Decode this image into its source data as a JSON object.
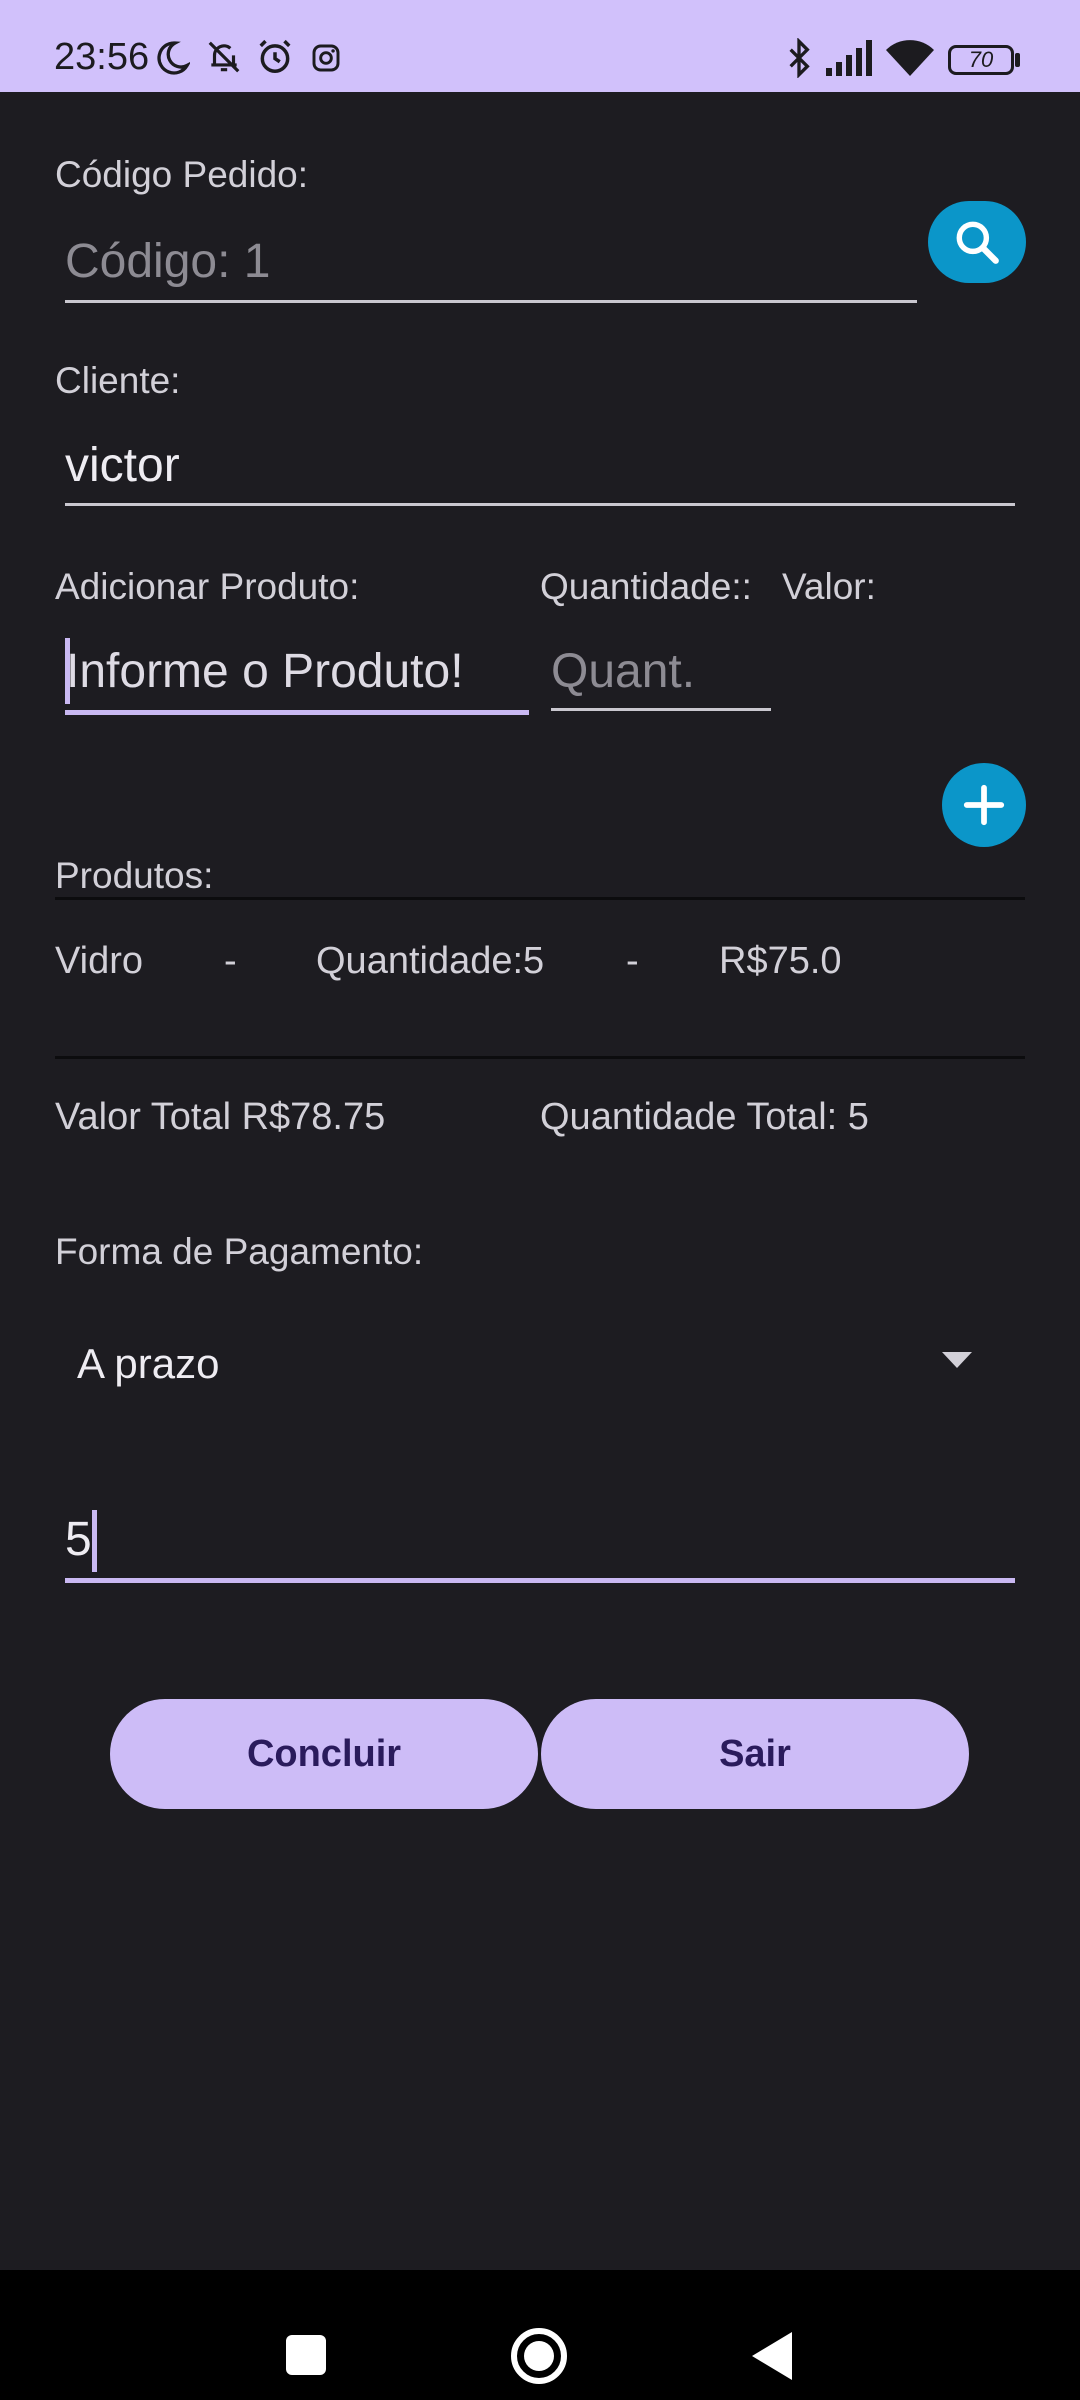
{
  "status_bar": {
    "time": "23:56",
    "battery": "70",
    "icons": [
      "moon-icon",
      "bell-off-icon",
      "alarm-icon",
      "instagram-icon",
      "bluetooth-icon",
      "signal-icon",
      "wifi-icon",
      "battery-icon"
    ]
  },
  "order": {
    "code_label": "Código Pedido:",
    "code_placeholder": "Código: 1",
    "search_icon": "search-icon"
  },
  "client": {
    "label": "Cliente:",
    "value": "victor"
  },
  "add_product": {
    "product_label": "Adicionar Produto:",
    "quantity_label": "Quantidade::",
    "value_label": "Valor:",
    "product_placeholder": "Informe o Produto!",
    "quantity_placeholder": "Quant.",
    "add_icon": "plus-icon"
  },
  "products": {
    "label": "Produtos:",
    "items": [
      {
        "name": "Vidro",
        "sep1": "-",
        "quantity": "Quantidade:5",
        "sep2": "-",
        "price": "R$75.0"
      }
    ]
  },
  "totals": {
    "total_value": "Valor Total R$78.75",
    "total_quantity": "Quantidade Total: 5"
  },
  "payment": {
    "label": "Forma de Pagamento:",
    "selected": "A prazo",
    "installments_value": "5"
  },
  "actions": {
    "conclude": "Concluir",
    "exit": "Sair"
  },
  "colors": {
    "background": "#1d1c21",
    "status_bar": "#d1c1fb",
    "accent_blue": "#0b96c9",
    "button": "#cdbcf7",
    "button_text": "#2a1b5c"
  }
}
